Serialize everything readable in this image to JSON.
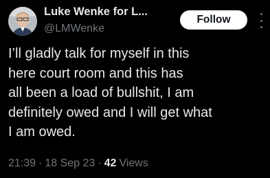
{
  "author": {
    "display_name": "Luke Wenke for L...",
    "handle": "@LMWenke",
    "avatar_icon": "profile-photo"
  },
  "actions": {
    "follow_label": "Follow",
    "more_icon": "more-vertical-icon"
  },
  "tweet": {
    "text": "I’ll gladly talk for myself in this\nhere court room and this has\nall been a load of bullshit, I am\ndefinitely owed and I will get what\nI am owed."
  },
  "meta": {
    "time": "21:39",
    "separator": "·",
    "date": "18 Sep 23",
    "views_count": "42",
    "views_label": "Views"
  },
  "colors": {
    "background": "#000000",
    "primary_text": "#e7e9ea",
    "secondary_text": "#71767b",
    "follow_bg": "#ffffff"
  }
}
